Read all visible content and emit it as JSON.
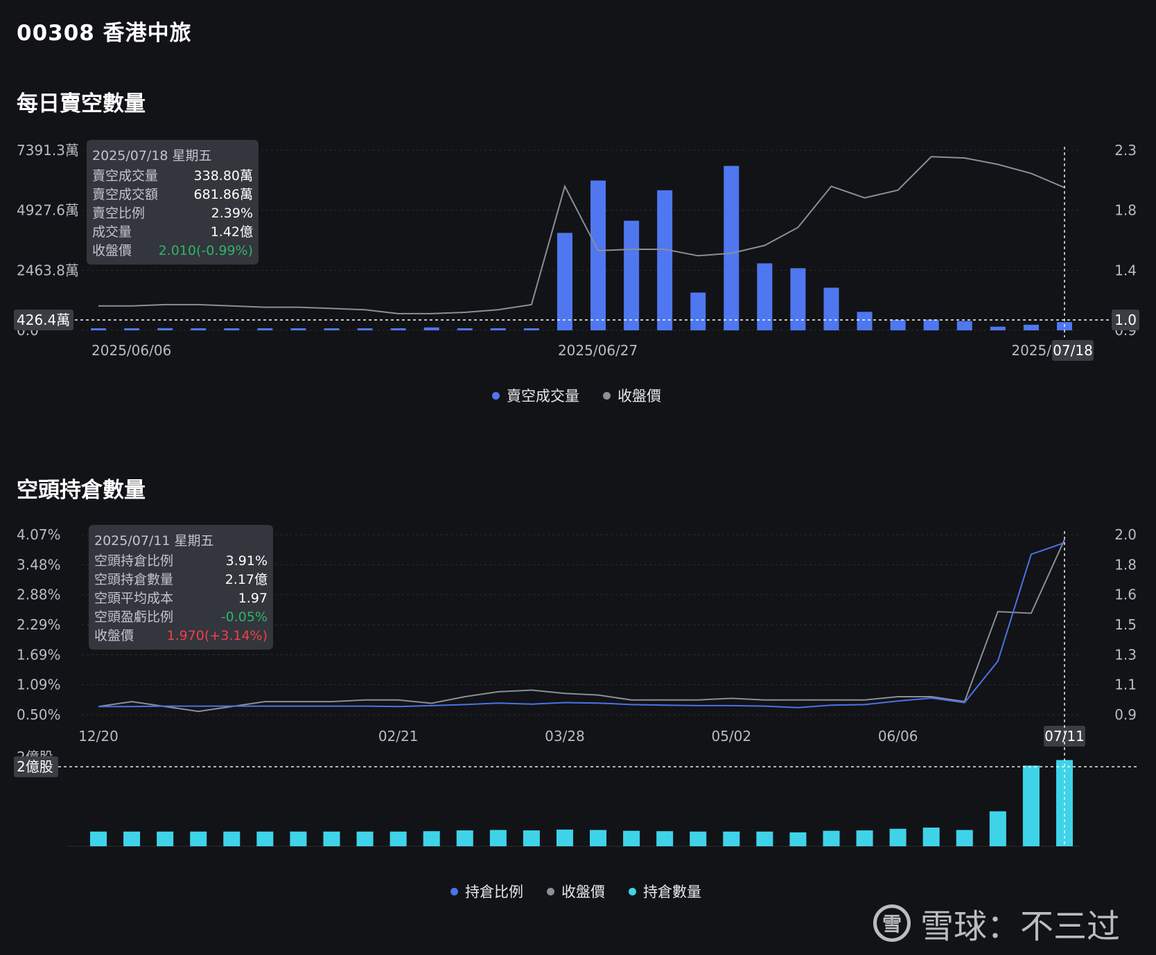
{
  "page": {
    "title": "00308  香港中旅"
  },
  "sections": {
    "short_selling": {
      "title": "每日賣空數量"
    },
    "short_position": {
      "title": "空頭持倉數量"
    }
  },
  "colors": {
    "background": "#121316",
    "bar_blue": "#4f77f0",
    "line_gray": "#8a8f99",
    "line_blue": "#4a73e8",
    "bar_cyan": "#3fd3ea",
    "positive_green": "#2fb36a",
    "negative_red": "#f0404a"
  },
  "tooltip1": {
    "date": "2025/07/18 星期五",
    "rows": [
      {
        "label": "賣空成交量",
        "value": "338.80萬"
      },
      {
        "label": "賣空成交額",
        "value": "681.86萬"
      },
      {
        "label": "賣空比例",
        "value": "2.39%"
      },
      {
        "label": "成交量",
        "value": "1.42億"
      },
      {
        "label": "收盤價",
        "value": "2.010(-0.99%)"
      }
    ]
  },
  "tooltip2": {
    "date": "2025/07/11 星期五",
    "rows": [
      {
        "label": "空頭持倉比例",
        "value": "3.91%"
      },
      {
        "label": "空頭持倉數量",
        "value": "2.17億"
      },
      {
        "label": "空頭平均成本",
        "value": "1.97"
      },
      {
        "label": "空頭盈虧比例",
        "value": "-0.05%"
      },
      {
        "label": "收盤價",
        "value": "1.970(+3.14%)"
      }
    ]
  },
  "legend1": [
    {
      "label": "賣空成交量",
      "color": "#4f77f0"
    },
    {
      "label": "收盤價",
      "color": "#8a8f99"
    }
  ],
  "legend2": [
    {
      "label": "持倉比例",
      "color": "#4a73e8"
    },
    {
      "label": "收盤價",
      "color": "#8a8f99"
    },
    {
      "label": "持倉數量",
      "color": "#3fd3ea"
    }
  ],
  "watermark": {
    "logo": "雪",
    "text": "雪球：不三过"
  },
  "chart_data": [
    {
      "type": "bar",
      "title": "每日賣空數量",
      "left_axis_ticks": [
        "7391.3萬",
        "4927.6萬",
        "2463.8萬",
        "0.0"
      ],
      "right_axis_ticks": [
        "2.3",
        "1.8",
        "1.4",
        "0.9"
      ],
      "crosshair_labels": {
        "left": "426.4萬",
        "right": "1.0",
        "x_prefix": "2025/",
        "x": "07/18"
      },
      "x_ticks": [
        "2025/06/06",
        "2025/06/27"
      ],
      "ylim_left": [
        0,
        7391.3
      ],
      "ylim_right": [
        0.9,
        2.3
      ],
      "series": [
        {
          "name": "賣空成交量",
          "type": "bar",
          "values": [
            40,
            30,
            90,
            20,
            80,
            80,
            20,
            60,
            20,
            60,
            120,
            20,
            30,
            20,
            4000,
            6150,
            4500,
            5750,
            1550,
            6750,
            2750,
            2550,
            1750,
            760,
            430,
            440,
            380,
            150,
            230,
            339
          ]
        },
        {
          "name": "收盤價",
          "type": "line",
          "values": [
            1.09,
            1.09,
            1.1,
            1.1,
            1.09,
            1.08,
            1.08,
            1.07,
            1.06,
            1.03,
            1.03,
            1.04,
            1.06,
            1.1,
            2.02,
            1.52,
            1.53,
            1.53,
            1.48,
            1.5,
            1.56,
            1.7,
            2.02,
            1.93,
            1.99,
            2.25,
            2.24,
            2.19,
            2.12,
            2.01
          ]
        }
      ]
    },
    {
      "type": "line",
      "title": "空頭持倉數量",
      "left_axis_ticks": [
        "4.07%",
        "3.48%",
        "2.88%",
        "2.29%",
        "1.69%",
        "1.09%",
        "0.50%"
      ],
      "right_axis_ticks": [
        "2.0",
        "1.8",
        "1.6",
        "1.5",
        "1.3",
        "1.1",
        "0.9"
      ],
      "x_ticks": [
        "12/20",
        "02/21",
        "03/28",
        "05/02",
        "06/06"
      ],
      "crosshair_x_label": "07/11",
      "ylim_left": [
        0.5,
        4.07
      ],
      "ylim_right": [
        0.9,
        2.0
      ],
      "series": [
        {
          "name": "持倉比例",
          "type": "line",
          "values": [
            0.66,
            0.66,
            0.67,
            0.67,
            0.67,
            0.67,
            0.67,
            0.67,
            0.67,
            0.66,
            0.68,
            0.7,
            0.73,
            0.71,
            0.74,
            0.73,
            0.7,
            0.69,
            0.68,
            0.68,
            0.67,
            0.64,
            0.69,
            0.7,
            0.77,
            0.83,
            0.74,
            1.56,
            3.68,
            3.91
          ]
        },
        {
          "name": "收盤價",
          "type": "line",
          "values": [
            0.95,
            0.98,
            0.95,
            0.92,
            0.95,
            0.98,
            0.98,
            0.98,
            0.99,
            0.99,
            0.97,
            1.01,
            1.04,
            1.05,
            1.03,
            1.02,
            0.99,
            0.99,
            0.99,
            1.0,
            0.99,
            0.99,
            0.99,
            0.99,
            1.01,
            1.01,
            0.98,
            1.53,
            1.52,
            1.97
          ]
        }
      ]
    },
    {
      "type": "bar",
      "title": "持倉數量",
      "left_axis_label": "2億股",
      "crosshair_label": "2億股",
      "ylim": [
        0,
        2.3
      ],
      "series": [
        {
          "name": "持倉數量",
          "values": [
            0.37,
            0.37,
            0.37,
            0.37,
            0.37,
            0.37,
            0.37,
            0.37,
            0.37,
            0.37,
            0.38,
            0.4,
            0.41,
            0.4,
            0.42,
            0.41,
            0.39,
            0.38,
            0.37,
            0.37,
            0.37,
            0.35,
            0.39,
            0.4,
            0.44,
            0.47,
            0.41,
            0.88,
            2.03,
            2.17
          ]
        }
      ]
    }
  ]
}
